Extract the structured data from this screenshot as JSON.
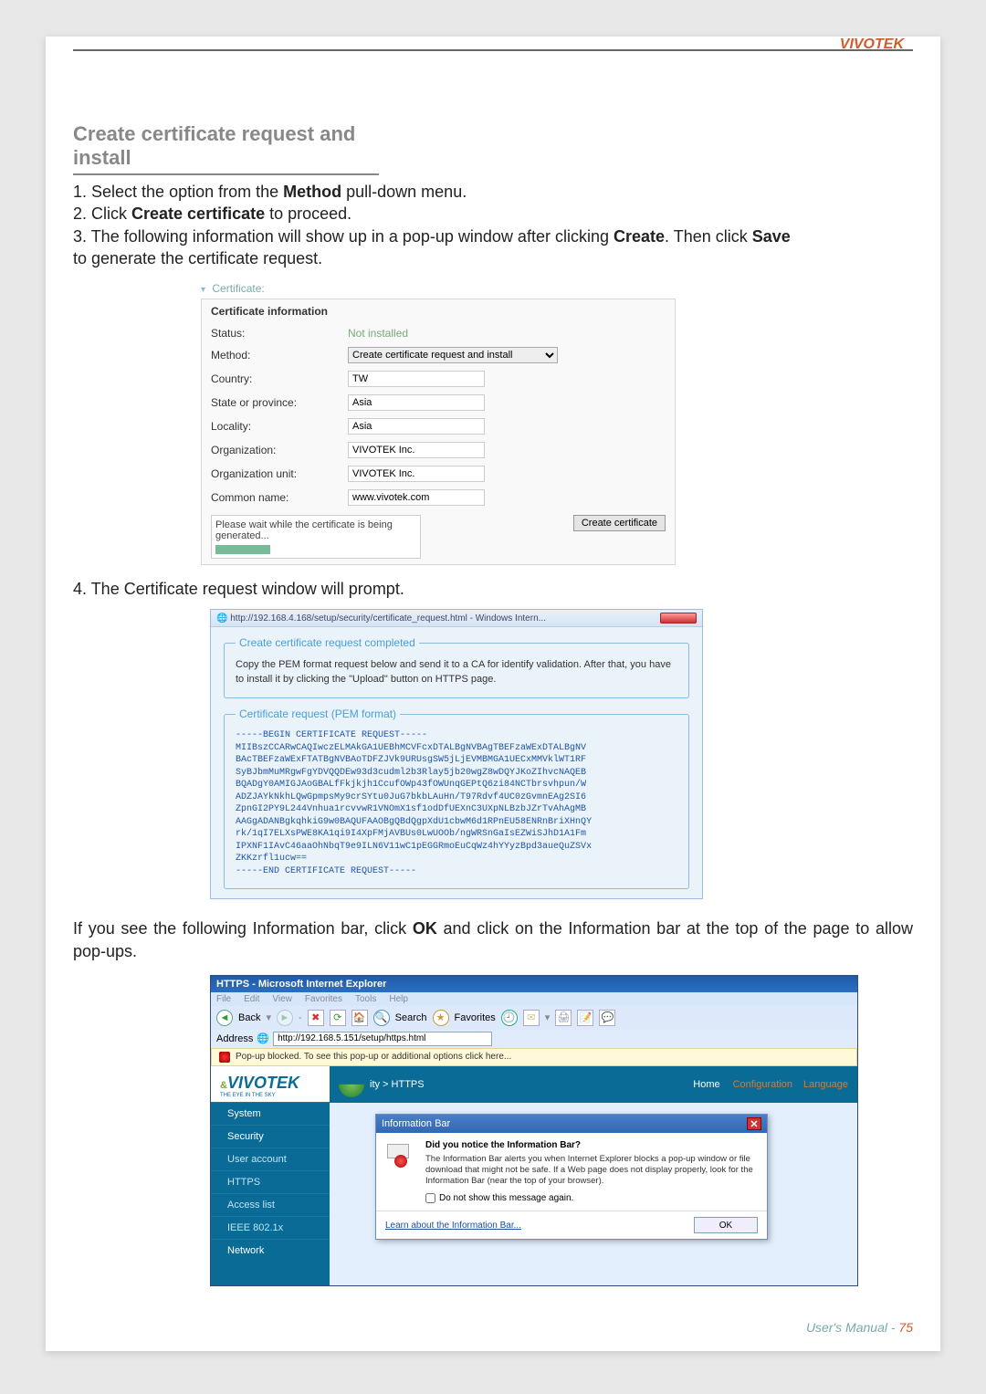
{
  "brand": "VIVOTEK",
  "section_title": "Create certificate request and install",
  "steps": {
    "s1a": "1. Select the option from the ",
    "s1b": "Method",
    "s1c": " pull-down menu.",
    "s2a": "2. Click ",
    "s2b": "Create certificate",
    "s2c": " to proceed.",
    "s3a": "3. The following information will show up in a pop-up window after clicking ",
    "s3b": "Create",
    "s3c": ". Then click ",
    "s3d": "Save",
    "s3e": "    to generate the certificate request.",
    "s4": "4. The Certificate request window will prompt."
  },
  "cert_panel": {
    "collapse_label": "Certificate:",
    "info_title": "Certificate information",
    "rows": {
      "status_lbl": "Status:",
      "status_val": "Not installed",
      "method_lbl": "Method:",
      "method_val": "Create certificate request and install",
      "country_lbl": "Country:",
      "country_val": "TW",
      "state_lbl": "State or province:",
      "state_val": "Asia",
      "locality_lbl": "Locality:",
      "locality_val": "Asia",
      "org_lbl": "Organization:",
      "org_val": "VIVOTEK Inc.",
      "orgunit_lbl": "Organization unit:",
      "orgunit_val": "VIVOTEK Inc.",
      "cn_lbl": "Common name:",
      "cn_val": "www.vivotek.com"
    },
    "wait_msg": "Please wait while the certificate is being generated...",
    "create_btn": "Create certificate"
  },
  "popup": {
    "url": "http://192.168.4.168/setup/security/certificate_request.html - Windows Intern...",
    "legend1": "Create certificate request completed",
    "inst": "Copy the PEM format request below and send it to a CA for identify validation. After that, you have to install it by clicking the \"Upload\" button on HTTPS page.",
    "legend2": "Certificate request (PEM format)",
    "pem": "-----BEGIN CERTIFICATE REQUEST-----\nMIIBszCCARwCAQIwczELMAkGA1UEBhMCVFcxDTALBgNVBAgTBEFzaWExDTALBgNV\nBAcTBEFzaWExFTATBgNVBAoTDFZJVk9URUsgSW5jLjEVMBMGA1UECxMMVklWT1RF\nSyBJbmMuMRgwFgYDVQQDEw93d3cudml2b3Rlay5jb20wgZ8wDQYJKoZIhvcNAQEB\nBQADgY0AMIGJAoGBALfFkjkjh1CcufOWp43fOWUnqGEPtQ6zi84NCTbrsvhpun/W\nADZJAYkNkhLQwGpmpsMy9crSYtu0JuG7bkbLAuHn/T97Rdvf4UC0zGvmnEAg2SI6\nZpnGI2PY9L244Vnhua1rcvvwR1VNOmX1sf1odDfUEXnC3UXpNLBzbJZrTvAhAgMB\nAAGgADANBgkqhkiG9w0BAQUFAAOBgQBdQgpXdU1cbwM6d1RPnEU58ENRnBriXHnQY\nrk/1qI7ELXsPWE8KA1qi9I4XpFMjAVBUs0LwUOOb/ngWRSnGaIsEZWiSJhD1A1Fm\nIPXNF1IAvC46aaOhNbqT9e9ILN6V11wC1pEGGRmoEuCqWz4hYYyzBpd3aueQuZSVx\nZKKzrfl1ucw==\n-----END CERTIFICATE REQUEST-----"
  },
  "info_para_a": "If you see the following Information bar, click ",
  "info_para_b": "OK",
  "info_para_c": " and click on the Information bar at the top of the page to allow pop-ups.",
  "browser": {
    "title": "HTTPS - Microsoft Internet Explorer",
    "menu": [
      "File",
      "Edit",
      "View",
      "Favorites",
      "Tools",
      "Help"
    ],
    "back": "Back",
    "search": "Search",
    "fav": "Favorites",
    "addr_lbl": "Address",
    "addr_val": "http://192.168.5.151/setup/https.html",
    "blocked": "Pop-up blocked. To see this pop-up or additional options click here...",
    "logo": "VIVOTEK",
    "logo_sub": "THE EYE IN THE SKY",
    "bc": "ity > HTTPS",
    "links": {
      "home": "Home",
      "config": "Configuration",
      "lang": "Language"
    },
    "sidebar": [
      "System",
      "Security",
      "User account",
      "HTTPS",
      "Access list",
      "IEEE 802.1x",
      "Network"
    ],
    "dialog": {
      "title": "Information Bar",
      "q": "Did you notice the Information Bar?",
      "body": "The Information Bar alerts you when Internet Explorer blocks a pop-up window or file download that might not be safe. If a Web page does not display properly, look for the Information Bar (near the top of your browser).",
      "chk": "Do not show this message again.",
      "learn": "Learn about the Information Bar...",
      "ok": "OK"
    }
  },
  "footer": {
    "um": "User's Manual - ",
    "page": "75"
  }
}
